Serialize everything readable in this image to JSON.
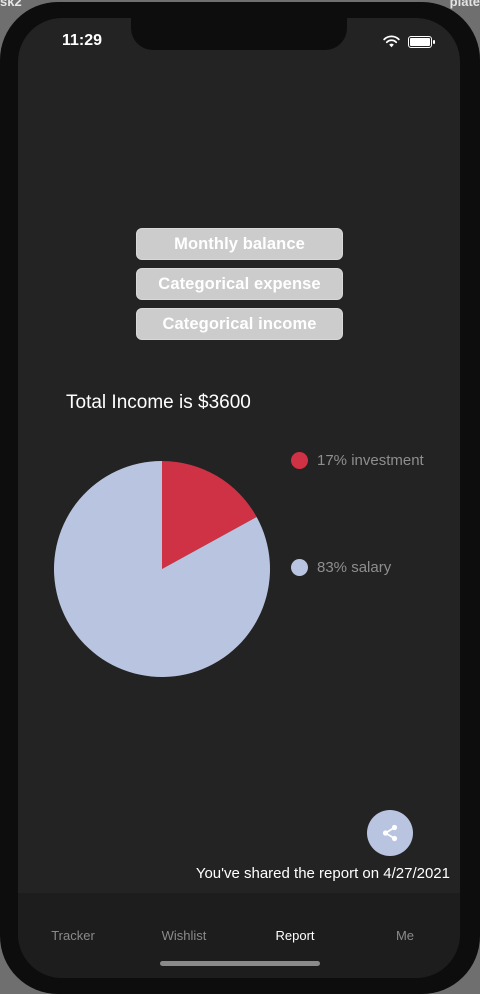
{
  "top_edge": {
    "left_fragment": "sk2",
    "right_fragment": "plate"
  },
  "status_bar": {
    "time": "11:29"
  },
  "report_buttons": [
    {
      "label": "Monthly balance"
    },
    {
      "label": "Categorical expense"
    },
    {
      "label": "Categorical income"
    }
  ],
  "chart_data": {
    "type": "pie",
    "title": "Total Income is $3600",
    "slices": [
      {
        "label": "17% investment",
        "percent": 17,
        "color": "#cf3244"
      },
      {
        "label": "83% salary",
        "percent": 83,
        "color": "#b9c5e0"
      }
    ]
  },
  "share": {
    "icon": "share-icon",
    "message": "You've shared the report on 4/27/2021"
  },
  "tab_bar": {
    "tabs": [
      {
        "label": "Tracker",
        "active": false
      },
      {
        "label": "Wishlist",
        "active": false
      },
      {
        "label": "Report",
        "active": true
      },
      {
        "label": "Me",
        "active": false
      }
    ]
  }
}
